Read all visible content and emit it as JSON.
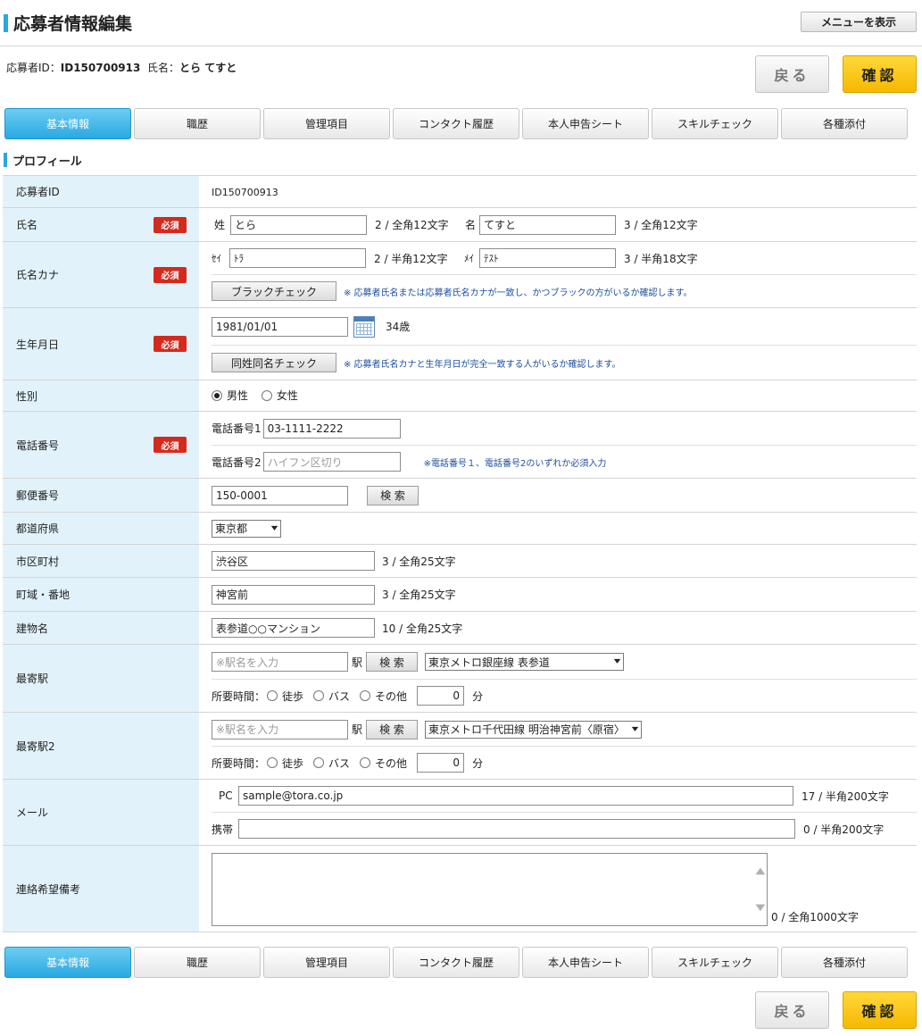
{
  "header": {
    "title": "応募者情報編集",
    "menu_button": "メニューを表示"
  },
  "applicant": {
    "id_label": "応募者ID：",
    "id_value": "ID150700913",
    "name_label": "氏名：",
    "name_value": "とら てすと"
  },
  "actions": {
    "back": "戻る",
    "confirm": "確認"
  },
  "tabs": [
    "基本情報",
    "職歴",
    "管理項目",
    "コンタクト履歴",
    "本人申告シート",
    "スキルチェック",
    "各種添付"
  ],
  "section_title": "プロフィール",
  "required_label": "必須",
  "fields": {
    "applicant_id": {
      "label": "応募者ID",
      "value": "ID150700913"
    },
    "name": {
      "label": "氏名",
      "sei_label": "姓",
      "sei_value": "とら",
      "sei_count": "2 / 全角12文字",
      "mei_label": "名",
      "mei_value": "てすと",
      "mei_count": "3 / 全角12文字"
    },
    "name_kana": {
      "label": "氏名カナ",
      "sei_label": "ｾｲ",
      "sei_value": "ﾄﾗ",
      "sei_count": "2 / 半角12文字",
      "mei_label": "ﾒｲ",
      "mei_value": "ﾃｽﾄ",
      "mei_count": "3 / 半角18文字",
      "check_button": "ブラックチェック",
      "check_note": "※ 応募者氏名または応募者氏名カナが一致し、かつブラックの方がいるか確認します。"
    },
    "birth": {
      "label": "生年月日",
      "value": "1981/01/01",
      "age": "34歳",
      "check_button": "同姓同名チェック",
      "check_note": "※ 応募者氏名カナと生年月日が完全一致する人がいるか確認します。"
    },
    "gender": {
      "label": "性別",
      "options": [
        "男性",
        "女性"
      ]
    },
    "phone": {
      "label": "電話番号",
      "phone1_label": "電話番号1",
      "phone1_value": "03-1111-2222",
      "phone2_label": "電話番号2",
      "phone2_placeholder": "ハイフン区切り",
      "note": "※電話番号１、電話番号2のいずれか必須入力"
    },
    "postal": {
      "label": "郵便番号",
      "value": "150-0001",
      "search_button": "検 索"
    },
    "prefecture": {
      "label": "都道府県",
      "selected": "東京都"
    },
    "city": {
      "label": "市区町村",
      "value": "渋谷区",
      "count": "3 / 全角25文字"
    },
    "town": {
      "label": "町域・番地",
      "value": "神宮前",
      "count": "3 / 全角25文字"
    },
    "building": {
      "label": "建物名",
      "value": "表参道○○マンション",
      "count": "10 / 全角25文字"
    },
    "station1": {
      "label": "最寄駅",
      "placeholder": "※駅名を入力",
      "eki": "駅",
      "search_button": "検 索",
      "selected": "東京メトロ銀座線 表参道",
      "time_label": "所要時間：",
      "options": [
        "徒歩",
        "バス",
        "その他"
      ],
      "minutes": "0",
      "unit": "分"
    },
    "station2": {
      "label": "最寄駅2",
      "placeholder": "※駅名を入力",
      "eki": "駅",
      "search_button": "検 索",
      "selected": "東京メトロ千代田線 明治神宮前〈原宿〉",
      "time_label": "所要時間：",
      "options": [
        "徒歩",
        "バス",
        "その他"
      ],
      "minutes": "0",
      "unit": "分"
    },
    "mail": {
      "label": "メール",
      "pc_label": "PC",
      "pc_value": "sample@tora.co.jp",
      "pc_count": "17 / 半角200文字",
      "mobile_label": "携帯",
      "mobile_value": "",
      "mobile_count": "0 / 半角200文字"
    },
    "remarks": {
      "label": "連絡希望備考",
      "value": "",
      "count": "0 / 全角1000文字"
    }
  },
  "colors": {
    "accent": "#29a8e0",
    "required": "#d42a1e",
    "confirm": "#f7b800",
    "label_bg": "#e2f2fa"
  }
}
